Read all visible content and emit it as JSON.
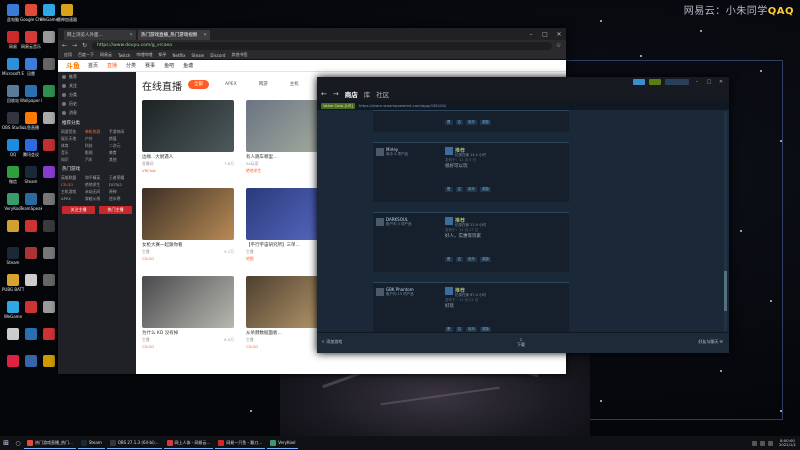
{
  "watermark": {
    "prefix": "网易云：小朱同学",
    "handle": "QAQ"
  },
  "desktop_icons": [
    {
      "label": "此电脑",
      "color": "#3b7bd8"
    },
    {
      "label": "Google Chrome",
      "color": "#e04b3a"
    },
    {
      "label": "WeGame",
      "color": "#2fa7e5"
    },
    {
      "label": "雷神加速器",
      "color": "#d9a219"
    },
    {
      "label": "网易",
      "color": "#cc2a2a"
    },
    {
      "label": "网易云音乐",
      "color": "#d33a3a"
    },
    {
      "label": "",
      "color": "#999"
    },
    {
      "label": "",
      "color": "#444"
    },
    {
      "label": "Microsoft Edge",
      "color": "#2e8ed8"
    },
    {
      "label": "迅雷",
      "color": "#3a7bdc"
    },
    {
      "label": "",
      "color": "#666"
    },
    {
      "label": "",
      "color": "#555"
    },
    {
      "label": "回收站",
      "color": "#5a7a9a"
    },
    {
      "label": "Wallpaper Engine",
      "color": "#2b6fb3"
    },
    {
      "label": "",
      "color": "#2f8f4f"
    },
    {
      "label": "",
      "color": "#777"
    },
    {
      "label": "OBS Studio",
      "color": "#303540"
    },
    {
      "label": "斗鱼直播",
      "color": "#ff7a00"
    },
    {
      "label": "",
      "color": "#aaa"
    },
    {
      "label": "",
      "color": "#666"
    },
    {
      "label": "QQ",
      "color": "#1f8be0"
    },
    {
      "label": "腾讯会议",
      "color": "#2f6be0"
    },
    {
      "label": "",
      "color": "#c03030"
    },
    {
      "label": "",
      "color": "#888"
    },
    {
      "label": "微信",
      "color": "#2ba03c"
    },
    {
      "label": "Steam",
      "color": "#1b2838"
    },
    {
      "label": "",
      "color": "#8a3ad0"
    },
    {
      "label": "",
      "color": "#555"
    },
    {
      "label": "VeryKool",
      "color": "#3a9a6a"
    },
    {
      "label": "TeamSpeak",
      "color": "#2a6aa0"
    },
    {
      "label": "",
      "color": "#777"
    },
    {
      "label": "",
      "color": "#444"
    },
    {
      "label": "",
      "color": "#d0a030"
    },
    {
      "label": "",
      "color": "#cc3333"
    },
    {
      "label": "",
      "color": "#3a3a3a"
    },
    {
      "label": "",
      "color": "#666"
    },
    {
      "label": "Steam",
      "color": "#1b2838"
    },
    {
      "label": "",
      "color": "#a33"
    },
    {
      "label": "",
      "color": "#777"
    },
    {
      "label": "",
      "color": "#555"
    },
    {
      "label": "PUBG BATTLEGROUNDS",
      "color": "#d8a32e"
    },
    {
      "label": "",
      "color": "#ccc"
    },
    {
      "label": "",
      "color": "#666"
    },
    {
      "label": "",
      "color": "#444"
    },
    {
      "label": "WeGame",
      "color": "#2fa7e5"
    },
    {
      "label": "",
      "color": "#c33"
    },
    {
      "label": "",
      "color": "#999"
    },
    {
      "label": "",
      "color": "#555"
    },
    {
      "label": "",
      "color": "#ccc"
    },
    {
      "label": "",
      "color": "#2b6fb3"
    },
    {
      "label": "",
      "color": "#c33"
    },
    {
      "label": "",
      "color": "#777"
    },
    {
      "label": "",
      "color": "#d24"
    },
    {
      "label": "",
      "color": "#36a"
    },
    {
      "label": "",
      "color": "#c90"
    },
    {
      "label": "",
      "color": "#666"
    }
  ],
  "browser": {
    "tabs": [
      {
        "label": "网上浏览人外面..."
      },
      {
        "label": "热门游戏直播_热门游戏视频"
      }
    ],
    "url": "https://www.douyu.com/g_vrcaea",
    "bookmarks": [
      "应用",
      "百度一下",
      "网易云",
      "Twitch",
      "哔哩哔哩",
      "知乎",
      "Netflix",
      "Steam",
      "Discord",
      "其他书签"
    ],
    "window_controls": [
      "–",
      "□",
      "✕"
    ]
  },
  "douyu": {
    "logo": "斗鱼",
    "nav": [
      "首页",
      "直播",
      "分类",
      "赛事",
      "鱼吧",
      "鱼塘"
    ],
    "nav_active": 1,
    "sidebar": {
      "top_items": [
        "推荐",
        "关注",
        "分类",
        "历史",
        "消息"
      ],
      "section1": "推荐分类",
      "grid1": [
        "网游竞技",
        "单机热游",
        "手游休闲",
        "娱乐天地",
        "户外",
        "颜值",
        "体育",
        "科技",
        "二次元",
        "音乐",
        "影视",
        "美食",
        "知识",
        "汽车",
        "其他"
      ],
      "section2": "热门游戏",
      "grid2": [
        "英雄联盟",
        "和平精英",
        "王者荣耀",
        "CS:GO",
        "绝地求生",
        "DOTA2",
        "主机游戏",
        "永劫无间",
        "原神",
        "APEX",
        "穿越火线",
        "逆水寒"
      ],
      "follow_labels": [
        "关注主播",
        "热门主播"
      ]
    },
    "title": "在线直播",
    "cats": [
      "全部",
      "APEX",
      "网游",
      "主机"
    ],
    "cats_active": 0,
    "cards": [
      {
        "title": "边缘...大厨遇人",
        "streamer": "直播间",
        "heat": "7.6万",
        "tag": "VRChat",
        "colors": [
          "#1d2224",
          "#4d5a5c"
        ]
      },
      {
        "title": "有人跳车哪里...",
        "streamer": "An玩家",
        "heat": "1.3万",
        "tag": "绝地求生",
        "colors": [
          "#6a7382",
          "#a9b1a0"
        ]
      },
      {
        "title": "女枪大赛一起跟你看",
        "streamer": "主播",
        "heat": "5.1万",
        "tag": "CS:GO",
        "colors": [
          "#3b2f25",
          "#b88a55"
        ]
      },
      {
        "title": "【平行宇宙研究所】三单...",
        "streamer": "主播",
        "heat": "2.2万",
        "tag": "地图",
        "colors": [
          "#2a3a7a",
          "#5b6cc8"
        ]
      },
      {
        "title": "为什么 KD 没有掉",
        "streamer": "主播",
        "heat": "8.9万",
        "tag": "CS:GO",
        "colors": [
          "#4a4a4e",
          "#b8b8b0"
        ]
      },
      {
        "title": "从杀戮数据面板...",
        "streamer": "主播",
        "heat": "3.4万",
        "tag": "CS:GO",
        "colors": [
          "#4d3f30",
          "#c0a070"
        ]
      }
    ]
  },
  "steam": {
    "nav": [
      "商店",
      "库",
      "社区"
    ],
    "nav_active": 0,
    "url_lock": "Valve Corp [US]",
    "url": "https://store.steampowered.com/app/438100/",
    "reviews": [
      {
        "user": "",
        "info": "",
        "title": "",
        "sub": "",
        "posted": "",
        "body": "",
        "helpful": [
          "是",
          "否",
          "欢乐",
          "奖励"
        ]
      },
      {
        "user": "Mirley",
        "info": "库中 4 项产品",
        "title": "推荐",
        "sub": "记录在案 14.2 小时",
        "posted": "发布于：12 月 5 日",
        "body": "很好可以玩",
        "helpful": [
          "是",
          "否",
          "欢乐",
          "奖励"
        ]
      },
      {
        "user": "DARKSOUL",
        "info": "账户内 3 项产品",
        "title": "推荐",
        "sub": "记录在案 21.9 小时",
        "posted": "发布于：11 月 27 日",
        "body": "好人，实惠等玩家",
        "helpful": [
          "是",
          "否",
          "欢乐",
          "奖励"
        ]
      },
      {
        "user": "GBK Phantom",
        "info": "账户内 15 项产品",
        "title": "推荐",
        "sub": "记录在案 87.4 小时",
        "posted": "发布于：11 月 21 日",
        "body": "好玩",
        "helpful": [
          "是",
          "否",
          "欢乐",
          "奖励"
        ]
      }
    ],
    "bottom": {
      "add_game": "添加游戏",
      "downloads": "下载",
      "friends": "好友与聊天"
    }
  },
  "taskbar": {
    "apps": [
      {
        "label": "热门游戏直播_热门...",
        "color": "#e04b3a"
      },
      {
        "label": "Steam",
        "color": "#1b2838"
      },
      {
        "label": "OBS 27.1.3 (64-bi)...",
        "color": "#303540"
      },
      {
        "label": "网上人体 - 网易云...",
        "color": "#d33a3a"
      },
      {
        "label": "网易一只鱼 - 飘刀...",
        "color": "#cc2a2a"
      },
      {
        "label": "VeryKool",
        "color": "#3a9a6a"
      }
    ],
    "time": "8:00:00",
    "date": "2022/1/1"
  }
}
